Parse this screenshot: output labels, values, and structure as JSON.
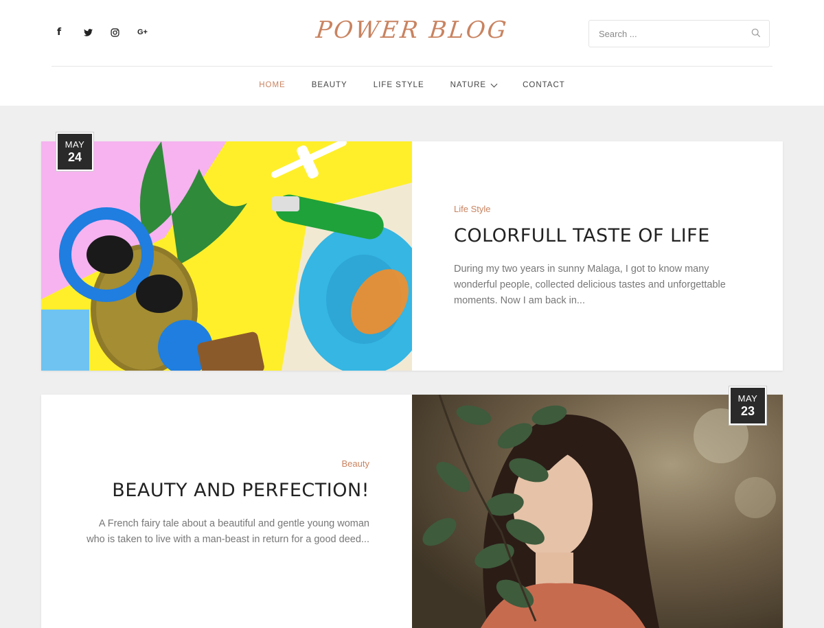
{
  "site": {
    "logo": "POWER BLOG"
  },
  "social": [
    {
      "name": "facebook",
      "glyph": "f"
    },
    {
      "name": "twitter"
    },
    {
      "name": "instagram"
    },
    {
      "name": "google-plus",
      "glyph": "G+"
    }
  ],
  "search": {
    "placeholder": "Search ..."
  },
  "nav": {
    "items": [
      {
        "label": "HOME",
        "active": true
      },
      {
        "label": "BEAUTY"
      },
      {
        "label": "LIFE STYLE"
      },
      {
        "label": "NATURE",
        "has_dropdown": true
      },
      {
        "label": "CONTACT"
      }
    ]
  },
  "colors": {
    "accent": "#c98360",
    "page_bg": "#efefef",
    "date_badge_bg": "#2a2a2a"
  },
  "posts": [
    {
      "date": {
        "month": "MAY",
        "day": "24"
      },
      "category": "Life Style",
      "title": "COLORFULL TASTE OF LIFE",
      "excerpt": "During my two years in sunny Malaga, I got to know many wonderful people, collected delicious tastes and unforgettable moments. Now I am back in..."
    },
    {
      "date": {
        "month": "MAY",
        "day": "23"
      },
      "category": "Beauty",
      "title": "BEAUTY AND PERFECTION!",
      "excerpt": "A French fairy tale about a beautiful and gentle young woman who is taken to live with a man-beast in return for a good deed..."
    }
  ]
}
